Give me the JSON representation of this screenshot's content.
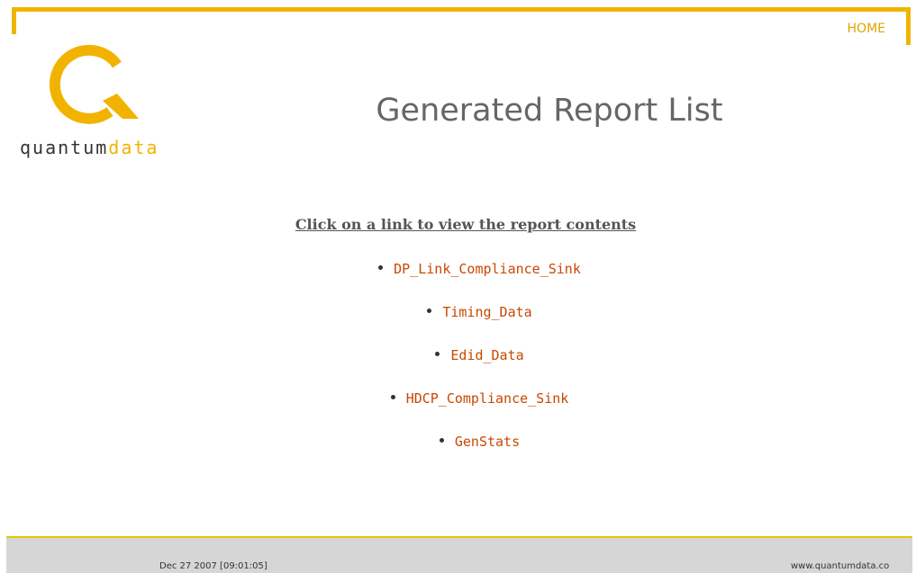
{
  "header": {
    "home_label": "HOME",
    "logo": {
      "wordmark_part1": "quantum",
      "wordmark_part2": "data",
      "brand_colors": {
        "accent": "#f2b300",
        "text": "#333333"
      }
    },
    "title": "Generated Report List"
  },
  "main": {
    "instruction": "Click on a link to view the report contents",
    "reports": [
      {
        "label": "DP_Link_Compliance_Sink"
      },
      {
        "label": "Timing_Data"
      },
      {
        "label": "Edid_Data"
      },
      {
        "label": "HDCP_Compliance_Sink"
      },
      {
        "label": "GenStats"
      }
    ],
    "link_color": "#c84800"
  },
  "footer": {
    "timestamp": "Dec 27 2007 [09:01:05]",
    "website": "www.quantumdata.co"
  },
  "colors": {
    "border_accent": "#f0b400",
    "footer_bg": "#d6d6d6",
    "title_gray": "#666666"
  }
}
